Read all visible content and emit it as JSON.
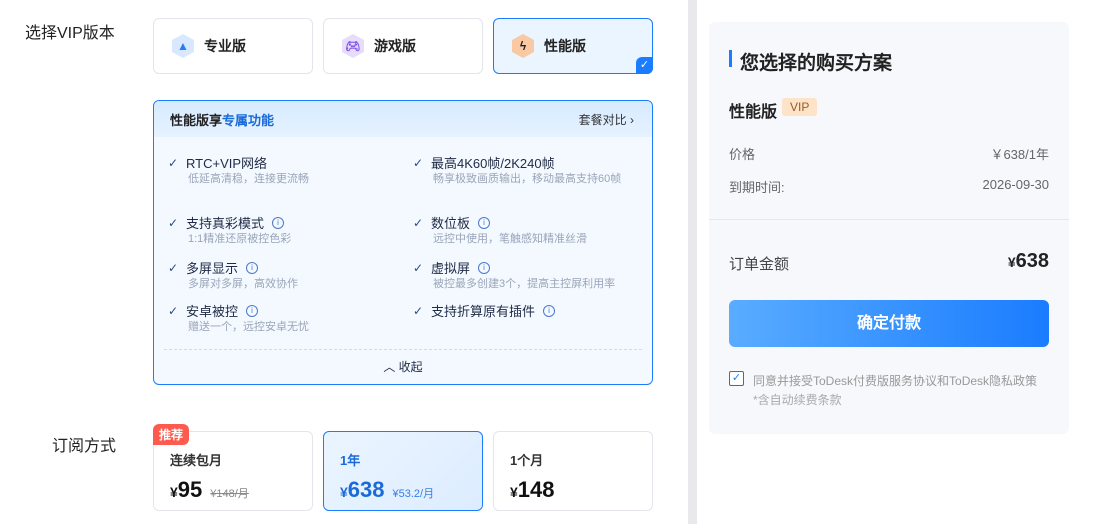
{
  "labels": {
    "vip_version": "选择VIP版本",
    "subscription": "订阅方式"
  },
  "versions": [
    {
      "label": "专业版",
      "icon": "navigation-arrow-icon",
      "color": "#2a7cf6"
    },
    {
      "label": "游戏版",
      "icon": "gamepad-icon",
      "color": "#7d4ee0"
    },
    {
      "label": "性能版",
      "icon": "lightning-icon",
      "color": "#f5b98a",
      "selected": true
    }
  ],
  "features_panel": {
    "title_prefix": "性能版享",
    "title_highlight": "专属功能",
    "compare": "套餐对比",
    "collapse": "收起",
    "items": [
      {
        "title": "RTC+VIP网络",
        "desc": "低延高清稳，连接更流畅",
        "info": false
      },
      {
        "title": "最高4K60帧/2K240帧",
        "desc": "畅享极致画质输出，移动最高支持60帧",
        "info": false
      },
      {
        "title": "支持真彩模式",
        "desc": "1:1精准还原被控色彩",
        "info": true
      },
      {
        "title": "数位板",
        "desc": "远控中使用，笔触感知精准丝滑",
        "info": true
      },
      {
        "title": "多屏显示",
        "desc": "多屏对多屏，高效协作",
        "info": true
      },
      {
        "title": "虚拟屏",
        "desc": "被控最多创建3个，提高主控屏利用率",
        "info": true
      },
      {
        "title": "安卓被控",
        "desc": "赠送一个，远控安卓无忧",
        "info": true
      },
      {
        "title": "支持折算原有插件",
        "desc": "",
        "info": true
      }
    ]
  },
  "subscriptions": [
    {
      "name": "连续包月",
      "currency": "¥",
      "price": "95",
      "extra": "¥148/月",
      "badge": "推荐",
      "strike": true
    },
    {
      "name": "1年",
      "currency": "¥",
      "price": "638",
      "extra": "¥53.2/月",
      "selected": true
    },
    {
      "name": "1个月",
      "currency": "¥",
      "price": "148",
      "extra": ""
    }
  ],
  "summary": {
    "title": "您选择的购买方案",
    "plan": "性能版",
    "badge": "VIP",
    "price_label": "价格",
    "price_value": "￥638/1年",
    "expire_label": "到期时间:",
    "expire_value": "2026-09-30",
    "total_label": "订单金额",
    "total_currency": "¥",
    "total_value": "638",
    "pay_button": "确定付款",
    "agree_text": "同意并接受ToDesk付费版服务协议和ToDesk隐私政策",
    "agree_note": "*含自动续费条款",
    "agree_checked": true
  },
  "colors": {
    "accent": "#1a7cff",
    "badge_red": "#ff5a4e"
  }
}
